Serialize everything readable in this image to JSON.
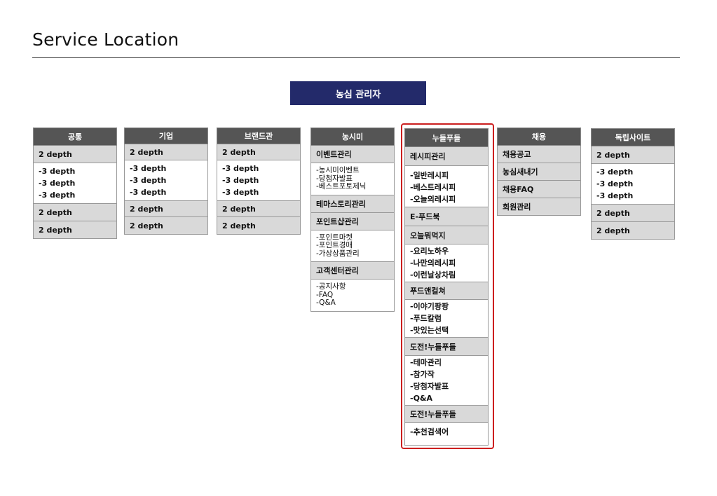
{
  "page": {
    "title": "Service Location"
  },
  "root": {
    "label": "농심 관리자"
  },
  "columns": [
    {
      "head": "공통",
      "blocks": [
        {
          "cat": "2 depth",
          "items": [
            "-3 depth",
            "-3 depth",
            "-3 depth"
          ]
        },
        {
          "cat": "2 depth",
          "items": []
        },
        {
          "cat": "2 depth",
          "items": []
        }
      ]
    },
    {
      "head": "기업",
      "blocks": [
        {
          "cat": "2 depth",
          "items": [
            "-3 depth",
            "-3 depth",
            "-3 depth"
          ]
        },
        {
          "cat": "2 depth",
          "items": []
        },
        {
          "cat": "2 depth",
          "items": []
        }
      ]
    },
    {
      "head": "브랜드관",
      "blocks": [
        {
          "cat": "2 depth",
          "items": [
            "-3 depth",
            "-3 depth",
            "-3 depth"
          ]
        },
        {
          "cat": "2 depth",
          "items": []
        },
        {
          "cat": "2 depth",
          "items": []
        }
      ]
    },
    {
      "head": "농시미",
      "blocks": [
        {
          "cat": "이벤트관리",
          "items": [
            "-농시미이벤트",
            "-당첨자발표",
            "-베스트포토제닉"
          ]
        },
        {
          "cat": "테마스토리관리",
          "items": []
        },
        {
          "cat": "포인트샵관리",
          "items": [
            "-포인트마켓",
            "-포인트경매",
            "-가상상품관리"
          ]
        },
        {
          "cat": "고객센터관리",
          "items": [
            "-공지사항",
            "-FAQ",
            "-Q&A"
          ]
        }
      ]
    },
    {
      "head": "누들푸들",
      "blocks": [
        {
          "cat": "레시피관리",
          "items": [
            "-일반레시피",
            "-베스트레시피",
            "-오늘의레시피"
          ]
        },
        {
          "cat": "E-푸드북",
          "items": []
        },
        {
          "cat": "오늘뭐먹지",
          "items": [
            "-요리노하우",
            "-나만의레시피",
            "-이런날상차림"
          ]
        },
        {
          "cat": "푸드앤컬쳐",
          "items": [
            "-이야기팡팡",
            "-푸드칼럼",
            "-맛있는선택"
          ]
        },
        {
          "cat": "도전!누들푸들",
          "items": [
            "-테마관리",
            "-참가작",
            "-당첨자발표",
            "-Q&A"
          ]
        },
        {
          "cat": "도전!누들푸들",
          "items": [
            "-추천검색어"
          ]
        }
      ]
    },
    {
      "head": "채용",
      "blocks": [
        {
          "cat": "채용공고",
          "items": []
        },
        {
          "cat": "농심새내기",
          "items": []
        },
        {
          "cat": "채용FAQ",
          "items": []
        },
        {
          "cat": "회원관리",
          "items": []
        }
      ]
    },
    {
      "head": "독립사이트",
      "blocks": [
        {
          "cat": "2 depth",
          "items": [
            "-3 depth",
            "-3 depth",
            "-3 depth"
          ]
        },
        {
          "cat": "2 depth",
          "items": []
        },
        {
          "cat": "2 depth",
          "items": []
        }
      ]
    }
  ],
  "colors": {
    "root_bg": "#232a6a",
    "head_bg": "#555555",
    "cat_bg": "#d9d9d9",
    "highlight": "#cc1f1f"
  }
}
